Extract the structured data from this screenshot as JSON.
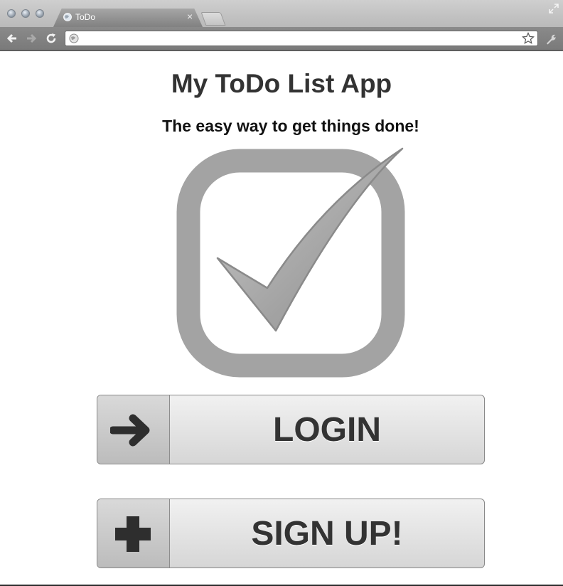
{
  "browser": {
    "tab_title": "ToDo",
    "tab_close": "×",
    "address_value": "",
    "address_placeholder": ""
  },
  "page": {
    "title": "My ToDo List App",
    "tagline": "The easy way to get things done!"
  },
  "buttons": {
    "login_label": "LOGIN",
    "signup_label": "SIGN UP!"
  },
  "colors": {
    "logo_gray": "#a3a3a3",
    "text_dark": "#333333"
  },
  "icons": {
    "login": "arrow-right-icon",
    "signup": "plus-icon"
  }
}
